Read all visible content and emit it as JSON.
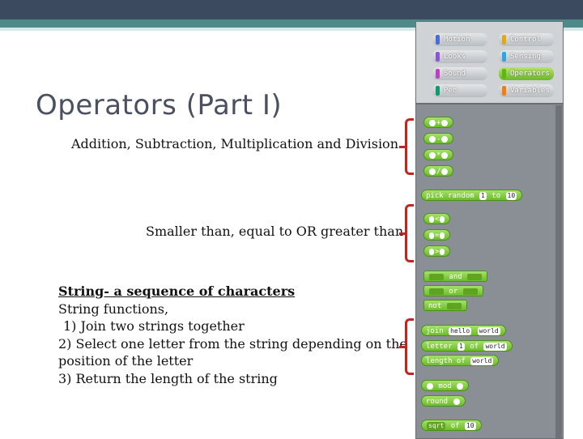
{
  "slide": {
    "title": "Operators (Part I)",
    "line1": "Addition, Subtraction, Multiplication and Division",
    "line2": "Smaller than, equal to OR greater than",
    "string_heading": "String- a sequence of characters",
    "string_functions": "String functions,",
    "item1": "1) Join two strings together",
    "item2a": "2) Select one letter from the string depending on the",
    "item2b": "position of the letter",
    "item3": "3) Return the length of the string"
  },
  "categories": [
    {
      "label": "Motion",
      "color": "#4a6cd4"
    },
    {
      "label": "Control",
      "color": "#e1a91a"
    },
    {
      "label": "Looks",
      "color": "#8a55d7"
    },
    {
      "label": "Sensing",
      "color": "#2ca5e2"
    },
    {
      "label": "Sound",
      "color": "#bb42c3"
    },
    {
      "label": "Operators",
      "color": "#5cb712"
    },
    {
      "label": "Pen",
      "color": "#0e9a6c"
    },
    {
      "label": "Variables",
      "color": "#ee7d16"
    }
  ],
  "blocks": {
    "plus": "+",
    "minus": "-",
    "times": "*",
    "divide": "/",
    "pick_random": "pick random",
    "pick_from": "1",
    "pick_to_label": "to",
    "pick_to": "10",
    "lt": "<",
    "eq": "=",
    "gt": ">",
    "and": "and",
    "or": "or",
    "not": "not",
    "join": "join",
    "join_a": "hello",
    "join_b": "world",
    "letter": "letter",
    "letter_n": "1",
    "letter_of": "of",
    "letter_word": "world",
    "length_of": "length of",
    "length_word": "world",
    "mod": "mod",
    "round": "round",
    "sqrt": "sqrt",
    "sqrt_of": "of",
    "sqrt_val": "10"
  },
  "colors": {
    "bracket": "#c0261f",
    "operator_green": "#6cbd2a",
    "panel_gray": "#8a8f95"
  }
}
